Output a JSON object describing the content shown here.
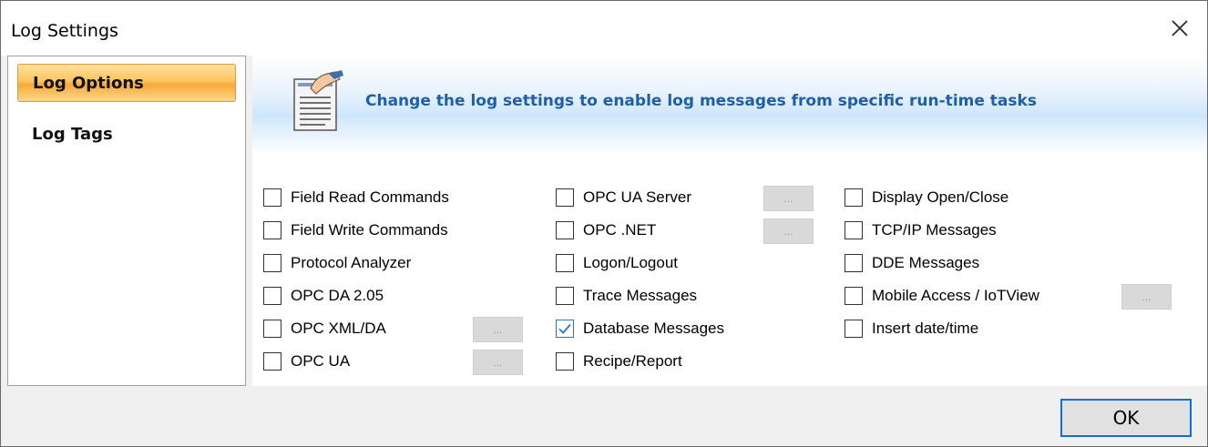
{
  "window": {
    "title": "Log Settings"
  },
  "sidebar": {
    "items": [
      {
        "label": "Log Options",
        "active": true
      },
      {
        "label": "Log Tags",
        "active": false
      }
    ]
  },
  "banner": {
    "text": "Change the log settings to enable log messages from specific run-time tasks",
    "icon": "notepad-pen-icon"
  },
  "options": {
    "col1": [
      {
        "label": "Field Read Commands",
        "checked": false
      },
      {
        "label": "Field Write Commands",
        "checked": false
      },
      {
        "label": "Protocol Analyzer",
        "checked": false
      },
      {
        "label": "OPC DA 2.05",
        "checked": false
      },
      {
        "label": "OPC XML/DA",
        "checked": false
      },
      {
        "label": "OPC UA",
        "checked": false
      }
    ],
    "col2": [
      {
        "label": "OPC UA Server",
        "checked": false
      },
      {
        "label": "OPC .NET",
        "checked": false
      },
      {
        "label": "Logon/Logout",
        "checked": false
      },
      {
        "label": "Trace Messages",
        "checked": false
      },
      {
        "label": "Database Messages",
        "checked": true
      },
      {
        "label": "Recipe/Report",
        "checked": false
      }
    ],
    "col3": [
      {
        "label": "Display Open/Close",
        "checked": false
      },
      {
        "label": "TCP/IP Messages",
        "checked": false
      },
      {
        "label": "DDE Messages",
        "checked": false
      },
      {
        "label": "Mobile Access / IoTView",
        "checked": false
      },
      {
        "label": "Insert date/time",
        "checked": false
      }
    ]
  },
  "ellipsis_label": "...",
  "footer": {
    "ok_label": "OK"
  },
  "colors": {
    "accent": "#1f5ea8",
    "selection": "#ffc45e",
    "focus": "#0f6fd6"
  }
}
